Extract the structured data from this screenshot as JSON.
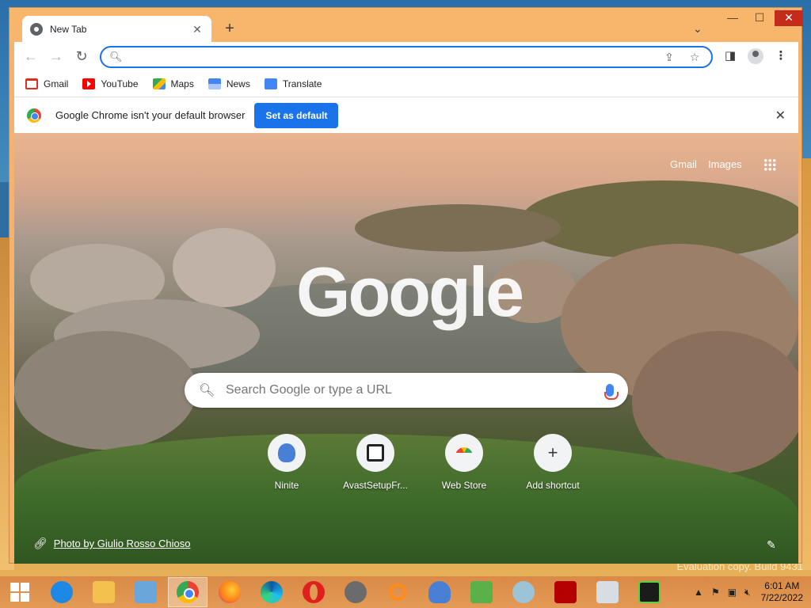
{
  "window": {
    "tab_title": "New Tab",
    "tab_close": "✕",
    "new_tab": "+",
    "tab_search": "⌄",
    "minimize": "—",
    "maximize": "☐",
    "close": "✕"
  },
  "toolbar": {
    "back": "←",
    "forward": "→",
    "reload": "↻",
    "omnibox_value": "",
    "share_icon": "⇪",
    "star_icon": "☆",
    "side_panel_icon": "◨",
    "menu_icon": "⋮"
  },
  "bookmarks": [
    {
      "label": "Gmail",
      "icon": "gmail-icon"
    },
    {
      "label": "YouTube",
      "icon": "youtube-icon"
    },
    {
      "label": "Maps",
      "icon": "maps-icon"
    },
    {
      "label": "News",
      "icon": "news-icon"
    },
    {
      "label": "Translate",
      "icon": "translate-icon"
    }
  ],
  "infobar": {
    "message": "Google Chrome isn't your default browser",
    "button": "Set as default",
    "close": "✕"
  },
  "ntp": {
    "gmail_link": "Gmail",
    "images_link": "Images",
    "logo_text": "Google",
    "search_placeholder": "Search Google or type a URL",
    "shortcuts": [
      {
        "label": "Ninite"
      },
      {
        "label": "AvastSetupFr..."
      },
      {
        "label": "Web Store"
      },
      {
        "label": "Add shortcut",
        "glyph": "+"
      }
    ],
    "photo_credit": "Photo by Giulio Rosso Chioso",
    "edit_icon": "✎"
  },
  "desktop": {
    "watermark": "Evaluation copy. Build 9431"
  },
  "taskbar": {
    "time": "6:01 AM",
    "date": "7/22/2022"
  },
  "colors": {
    "accent": "#1a73e8",
    "tabstrip": "#f8b56c",
    "taskbar": "#e39a55",
    "close_red": "#c42b1c"
  }
}
